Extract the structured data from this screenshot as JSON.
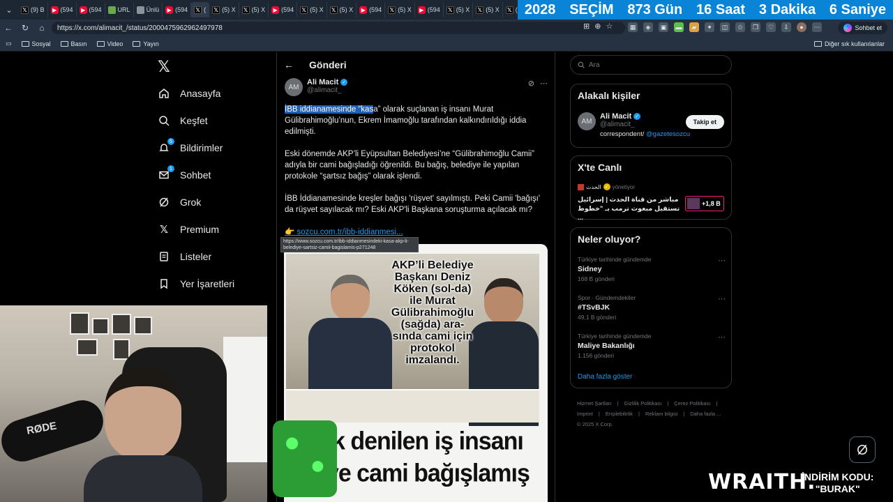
{
  "browser": {
    "tabs": [
      {
        "icon": "x",
        "label": "(9) B"
      },
      {
        "icon": "yt",
        "label": "(594"
      },
      {
        "icon": "yt",
        "label": "(594"
      },
      {
        "icon": "doc",
        "label": "URL"
      },
      {
        "icon": "gen",
        "label": "Ünlü"
      },
      {
        "icon": "yt",
        "label": "(594"
      },
      {
        "icon": "x",
        "label": "(",
        "active": true
      },
      {
        "icon": "x",
        "label": "(5) X"
      },
      {
        "icon": "x",
        "label": "(5) X"
      },
      {
        "icon": "yt",
        "label": "(594"
      },
      {
        "icon": "x",
        "label": "(5) X"
      },
      {
        "icon": "x",
        "label": "(5) X"
      },
      {
        "icon": "yt",
        "label": "(594"
      },
      {
        "icon": "x",
        "label": "(5) X"
      },
      {
        "icon": "yt",
        "label": "(594"
      },
      {
        "icon": "x",
        "label": "(5) X"
      },
      {
        "icon": "x",
        "label": "(5) X"
      },
      {
        "icon": "x",
        "label": "(5)"
      }
    ],
    "countdown": [
      "2028",
      "SEÇİM",
      "873 Gün",
      "16 Saat",
      "3 Dakika",
      "6 Saniye"
    ],
    "url": "https://x.com/alimacit_/status/2000475962962497978",
    "copilot_label": "Sohbet et",
    "bookmarks": [
      "Sosyal",
      "Basın",
      "Video",
      "Yayın"
    ],
    "other_bookmarks": "Diğer sık kullanılanlar"
  },
  "sidenav": {
    "items": [
      {
        "label": "Anasayfa",
        "icon": "home-icon"
      },
      {
        "label": "Keşfet",
        "icon": "search-icon"
      },
      {
        "label": "Bildirimler",
        "icon": "bell-icon",
        "badge": "5"
      },
      {
        "label": "Sohbet",
        "icon": "mail-icon",
        "badge": "1"
      },
      {
        "label": "Grok",
        "icon": "grok-icon"
      },
      {
        "label": "Premium",
        "icon": "x-icon"
      },
      {
        "label": "Listeler",
        "icon": "list-icon"
      },
      {
        "label": "Yer İşaretleri",
        "icon": "bookmark-icon"
      }
    ]
  },
  "post": {
    "header_title": "Gönderi",
    "author_name": "Ali Macit",
    "author_handle": "@alimacit_",
    "para1_highlight": "İBB iddianamesinde “kas",
    "para1_rest": "a” olarak suçlanan iş insanı Murat Gülibrahimoğlu’nun, Ekrem İmamoğlu tarafından kalkındırıldığı iddia edilmişti.",
    "para2": "Eski dönemde AKP’li Eyüpsultan Belediyesi’ne “Gülibrahimoğlu Camii” adıyla bir cami bağışladığı öğrenildi. Bu bağış, belediye ile yapılan protokole “şartsız bağış” olarak işlendi.",
    "para3": "İBB İddianamesinde kreşler bağışı 'rüşvet' sayılmıştı. Peki Camii 'bağışı' da rüşvet sayılacak mı? Eski AKP'li Başkana soruşturma açılacak mı?",
    "link_emoji": "👉",
    "link_text": "sozcu.com.tr/ibb-iddianmesi...",
    "tooltip": "https://www.sozcu.com.tr/ibb-iddianmesindeki-kasa-akp-li-belediye-sartsiz-camii-bagislamis-p271248",
    "image_caption": "AKP’li Belediye Başkanı Deniz Köken (sol-da) ile Murat Gülibrahimoğlu (sağda) ara-sında cami için protokol imzalandı.",
    "image_headline_1": "...ık denilen iş insanı",
    "image_headline_2": "...’ye cami bağışlamış"
  },
  "right": {
    "search_placeholder": "Ara",
    "related_title": "Alakalı kişiler",
    "related_name": "Ali Macit",
    "related_handle": "@alimacit_",
    "related_bio": "correspondent/",
    "related_bio_link": "@gazetesozcu",
    "follow_label": "Takip et",
    "live_title": "X'te Canlı",
    "live_source": "الحدث",
    "live_status": "yönetiyor",
    "live_text": "مباشر من قناة الحدث | إسرائيل تستقبل مبعوث ترمب بـ \"خطوط ...",
    "live_count": "+1,8 B",
    "trends_title": "Neler oluyor?",
    "trends": [
      {
        "meta": "Türkiye tarihinde gündemde",
        "name": "Sidney",
        "count": "168 B gönderi"
      },
      {
        "meta": "Spor · Gündemdekiler",
        "name": "#TSvBJK",
        "count": "49,1 B gönderi"
      },
      {
        "meta": "Türkiye tarihinde gündemde",
        "name": "Maliye Bakanlığı",
        "count": "1.156 gönderi"
      }
    ],
    "show_more": "Daha fazla göster",
    "footer": [
      "Hizmet Şartları",
      "|",
      "Gizlilik Politikası",
      "|",
      "Çerez Politikası",
      "|",
      "Imprint",
      "|",
      "Erişilebilirlik",
      "|",
      "Reklam bilgisi",
      "|",
      "Daha fazla ...",
      "© 2025 X Corp."
    ]
  },
  "overlay": {
    "mic_brand": "RØDE",
    "sponsor": "WRAITH.",
    "discount_line1": "İNDİRİM KODU:",
    "discount_line2": "\"BURAK\""
  }
}
